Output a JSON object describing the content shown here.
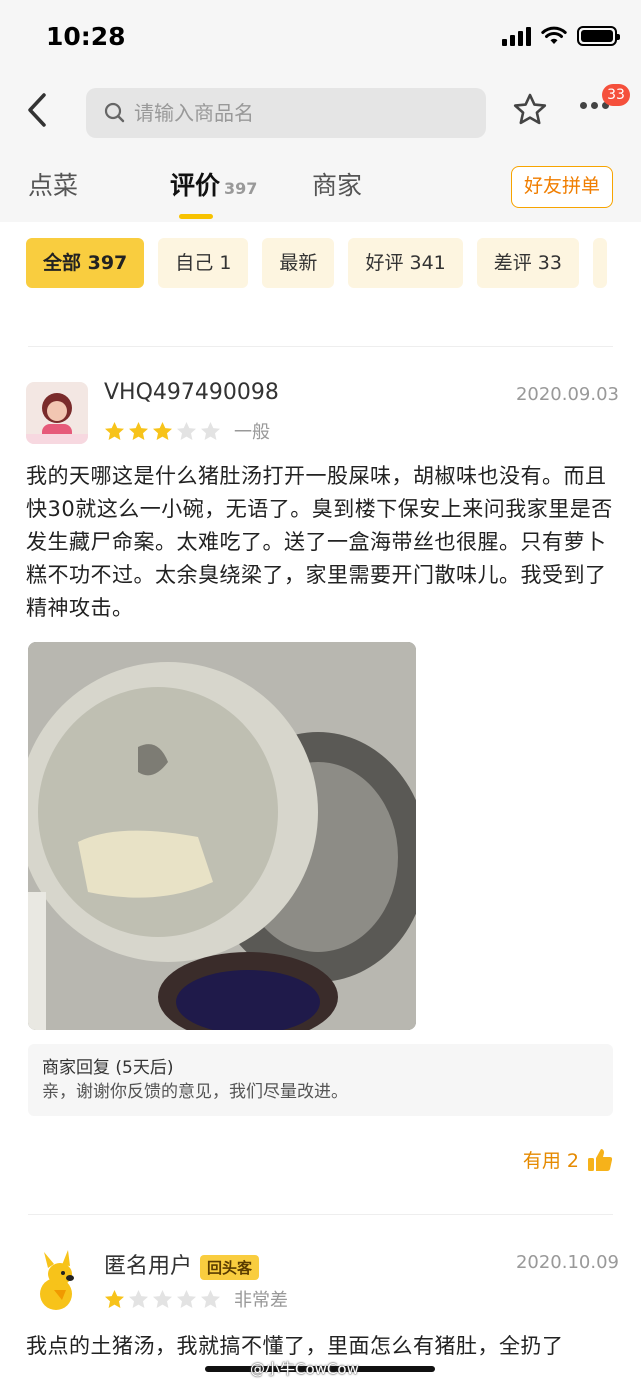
{
  "status_bar": {
    "time": "10:28"
  },
  "nav": {
    "back_icon": "chevron-left-icon",
    "search_placeholder": "请输入商品名",
    "favorite_icon": "star-outline-icon",
    "more_icon": "more-dots-icon",
    "more_badge": "33"
  },
  "tabs": [
    {
      "label": "点菜"
    },
    {
      "label": "评价",
      "count": "397"
    },
    {
      "label": "商家"
    }
  ],
  "group_order_label": "好友拼单",
  "filters": [
    {
      "label": "全部 397"
    },
    {
      "label": "自己 1"
    },
    {
      "label": "最新"
    },
    {
      "label": "好评 341"
    },
    {
      "label": "差评 33"
    }
  ],
  "reviews": [
    {
      "user": "VHQ497490098",
      "date": "2020.09.03",
      "rating": 3,
      "rating_word": "一般",
      "text": "我的天哪这是什么猪肚汤打开一股屎味，胡椒味也没有。而且快30就这么一小碗，无语了。臭到楼下保安上来问我家里是否发生藏尸命案。太难吃了。送了一盒海带丝也很腥。只有萝卜糕不功不过。太余臭绕梁了，家里需要开门散味儿。我受到了精神攻击。",
      "reply_title": "商家回复 (5天后)",
      "reply_text": "亲，谢谢你反馈的意见，我们尽量改进。",
      "useful_label": "有用 2"
    },
    {
      "user": "匿名用户",
      "tag": "回头客",
      "date": "2020.10.09",
      "rating": 1,
      "rating_word": "非常差",
      "text": "我点的土猪汤，我就搞不懂了，里面怎么有猪肚，全扔了"
    }
  ],
  "watermark": "@小牛CowCow",
  "colors": {
    "accent": "#f9cd3f",
    "chip_bg": "#fdf5e0",
    "orange": "#e58a00",
    "badge": "#f5503c"
  }
}
